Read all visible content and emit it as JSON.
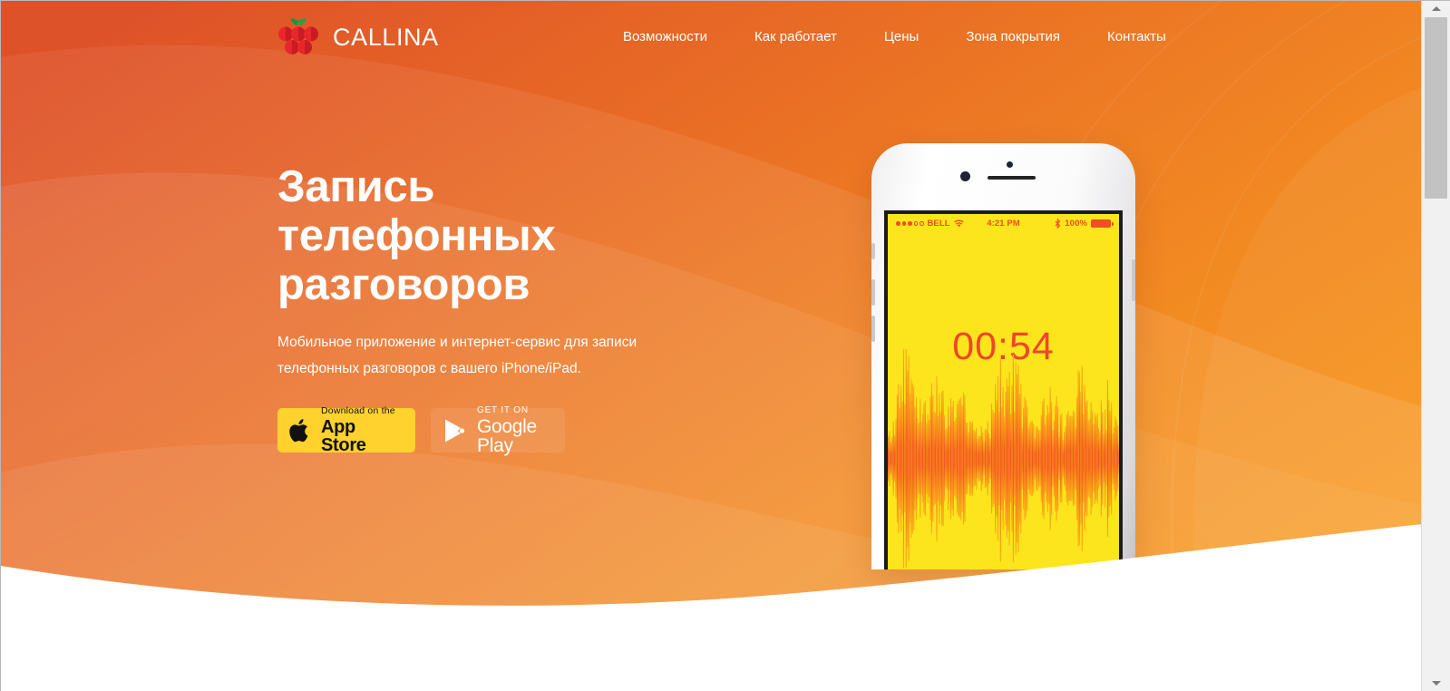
{
  "brand": {
    "name": "CALLINA",
    "logo_icon": "berry-cluster-icon",
    "berry_color": "#E8262B",
    "leaf_color": "#0E9B3C"
  },
  "nav": {
    "items": [
      {
        "label": "Возможности"
      },
      {
        "label": "Как работает"
      },
      {
        "label": "Цены"
      },
      {
        "label": "Зона покрытия"
      },
      {
        "label": "Контакты"
      }
    ]
  },
  "hero": {
    "title": "Запись телефонных разговоров",
    "subtitle": "Мобильное приложение и интернет-сервис для записи телефонных разговоров с вашего iPhone/iPad.",
    "gradient_from": "#E0562A",
    "gradient_to": "#F79420"
  },
  "badges": {
    "appstore": {
      "small": "Download on the",
      "big": "App Store",
      "icon": "apple-logo-icon",
      "bg": "#FFD22E"
    },
    "googleplay": {
      "small": "GET IT ON",
      "big": "Google Play",
      "icon": "google-play-triangle-icon",
      "bg": "rgba(255,255,255,0.09)"
    }
  },
  "phone": {
    "statusbar": {
      "carrier": "BELL",
      "signal_icon": "signal-dots-icon",
      "wifi_icon": "wifi-icon",
      "time": "4:21 PM",
      "bluetooth_icon": "bluetooth-icon",
      "battery_percent": "100%",
      "battery_icon": "battery-full-icon"
    },
    "timer": "00:54",
    "screen_bg": "#FCE51C",
    "accent": "#F0452B",
    "waveform_icon": "audio-waveform-icon"
  },
  "scrollbar": {
    "up_icon": "scroll-up-arrow-icon",
    "down_icon": "scroll-down-arrow-icon",
    "thumb": "scroll-thumb"
  }
}
